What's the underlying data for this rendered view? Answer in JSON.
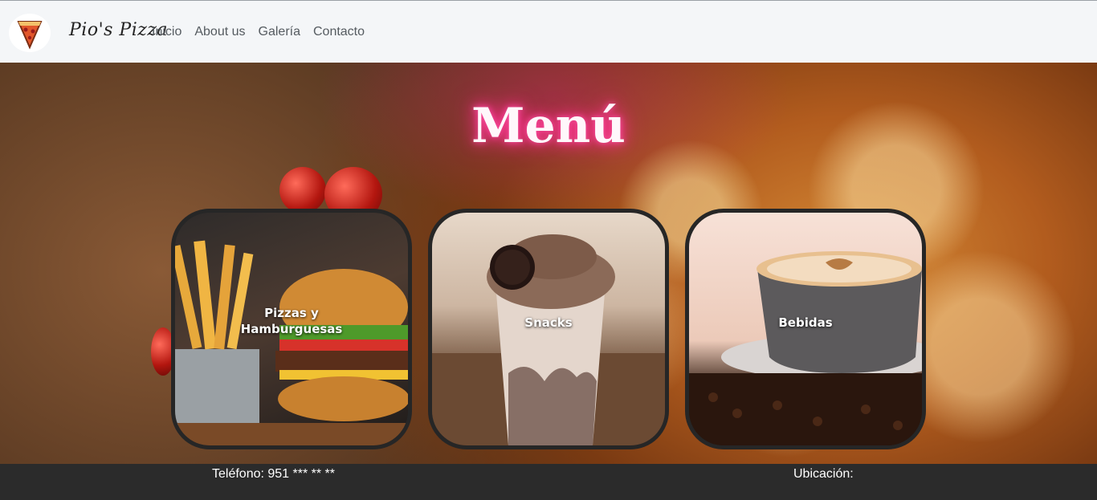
{
  "navbar": {
    "brand": "Pio's Pizza",
    "logo_icon": "pizza-slice-logo-icon",
    "links": [
      "Inicio",
      "About us",
      "Galería",
      "Contacto"
    ]
  },
  "hero": {
    "title": "Menú",
    "cards": [
      {
        "label_line1": "Pizzas y",
        "label_line2": "Hamburguesas",
        "image": "fries-and-burger"
      },
      {
        "label": "Snacks",
        "image": "chocolate-milkshake"
      },
      {
        "label": "Bebidas",
        "image": "coffee-cup"
      }
    ]
  },
  "footer": {
    "phone": "Teléfono: 951 *** ** **",
    "location": "Ubicación:"
  },
  "colors": {
    "navbar_bg": "#f4f6f8",
    "footer_bg": "#2b2b2b",
    "title_glow": "#ff2e8c",
    "card_border": "#262626"
  }
}
